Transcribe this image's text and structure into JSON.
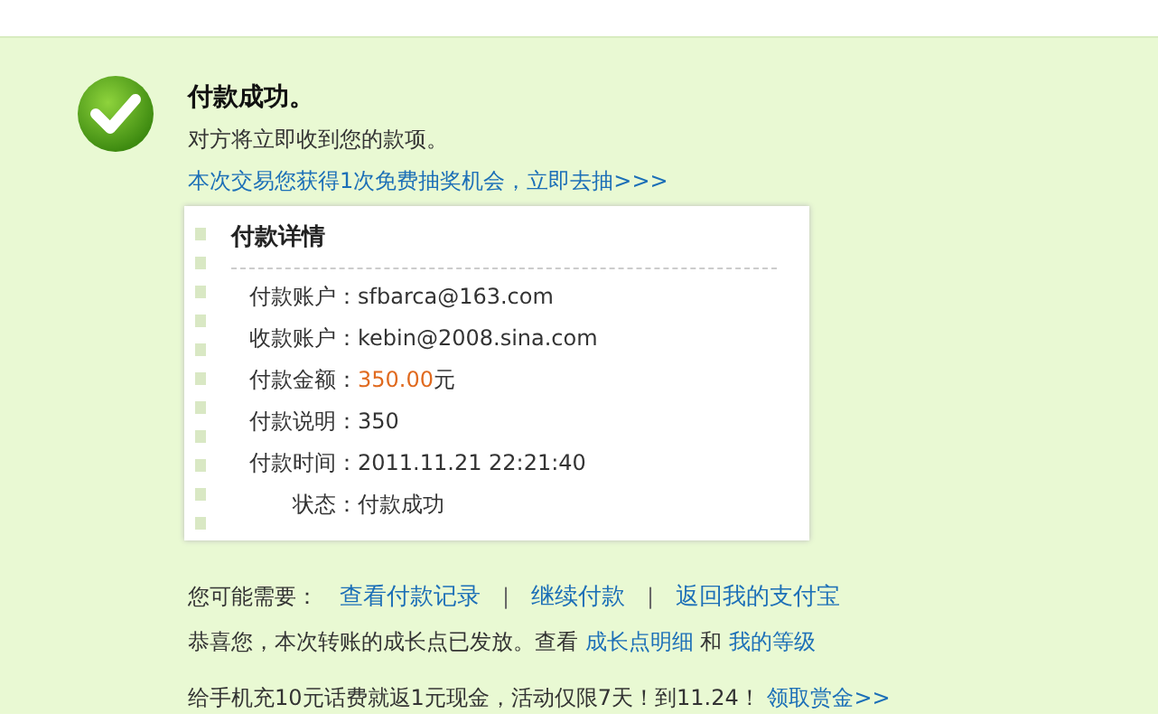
{
  "result": {
    "title": "付款成功。",
    "subtitle": "对方将立即收到您的款项。",
    "lottery_link": "本次交易您获得1次免费抽奖机会，立即去抽>>>"
  },
  "details": {
    "title": "付款详情",
    "rows": [
      {
        "kind": "text",
        "label": "付款账户：",
        "value": "sfbarca@163.com"
      },
      {
        "kind": "text",
        "label": "收款账户：",
        "value": "kebin@2008.sina.com"
      },
      {
        "kind": "amount",
        "label": "付款金额：",
        "value": "350.00",
        "unit": "元"
      },
      {
        "kind": "text",
        "label": "付款说明：",
        "value": "350"
      },
      {
        "kind": "text",
        "label": "付款时间：",
        "value": "2011.11.21 22:21:40"
      },
      {
        "kind": "text",
        "label": "状态：",
        "value": "付款成功"
      }
    ]
  },
  "suggestions": {
    "label": "您可能需要：",
    "links": [
      "查看付款记录",
      "继续付款",
      "返回我的支付宝"
    ],
    "separator": "|"
  },
  "growth": {
    "text": "恭喜您，本次转账的成长点已发放。查看",
    "link_1": "成长点明细",
    "joiner": "和",
    "link_2": "我的等级"
  },
  "promo": {
    "text": "给手机充10元话费就返1元现金，活动仅限7天！到11.24！",
    "link": "领取赏金>>"
  }
}
